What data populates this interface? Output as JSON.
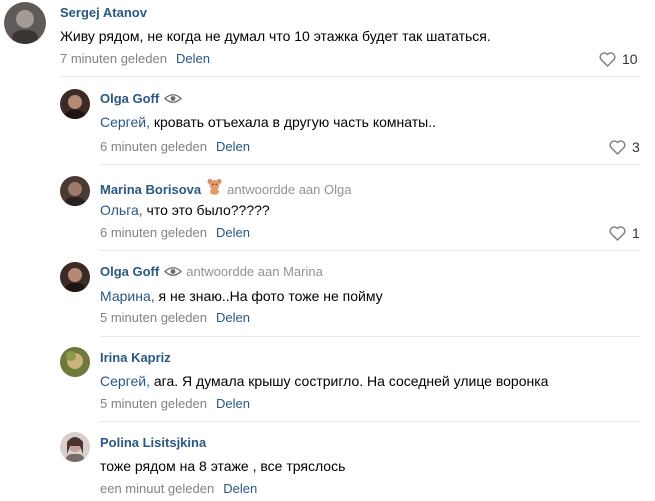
{
  "comments": [
    {
      "author": "Sergej Atanov",
      "badge": "",
      "reply_to": "",
      "mention": "",
      "text": "Живу рядом, не когда не думал что 10 этажка будет так шататься.",
      "time": "7 minuten geleden",
      "share": "Delen",
      "likes": "10"
    },
    {
      "author": "Olga Goff",
      "badge": "eye-icon",
      "reply_to": "",
      "mention": "Сергей,",
      "text": " кровать отъехала в другую часть комнаты..",
      "time": "6 minuten geleden",
      "share": "Delen",
      "likes": "3"
    },
    {
      "author": "Marina Borisova",
      "badge": "teddy-bear-icon",
      "reply_to": "antwoordde aan Olga",
      "mention": "Ольга,",
      "text": " что это было?????",
      "time": "6 minuten geleden",
      "share": "Delen",
      "likes": "1"
    },
    {
      "author": "Olga Goff",
      "badge": "eye-icon",
      "reply_to": "antwoordde aan Marina",
      "mention": "Марина,",
      "text": " я не знаю..На фото тоже не пойму",
      "time": "5 minuten geleden",
      "share": "Delen",
      "likes": ""
    },
    {
      "author": "Irina Kapriz",
      "badge": "",
      "reply_to": "",
      "mention": "Сергей,",
      "text": " ага. Я думала крышу состригло. На соседней улице воронка",
      "time": "5 minuten geleden",
      "share": "Delen",
      "likes": ""
    },
    {
      "author": "Polina Lisitsjkina",
      "badge": "",
      "reply_to": "",
      "mention": "",
      "text": "тоже рядом на 8 этаже , все тряслось",
      "time": "een minuut geleden",
      "share": "Delen",
      "likes": ""
    }
  ],
  "icons": {
    "like": "heart-outline-icon"
  },
  "colors": {
    "link": "#2a5885",
    "meta": "#828282",
    "divider": "#e7e8ec"
  }
}
